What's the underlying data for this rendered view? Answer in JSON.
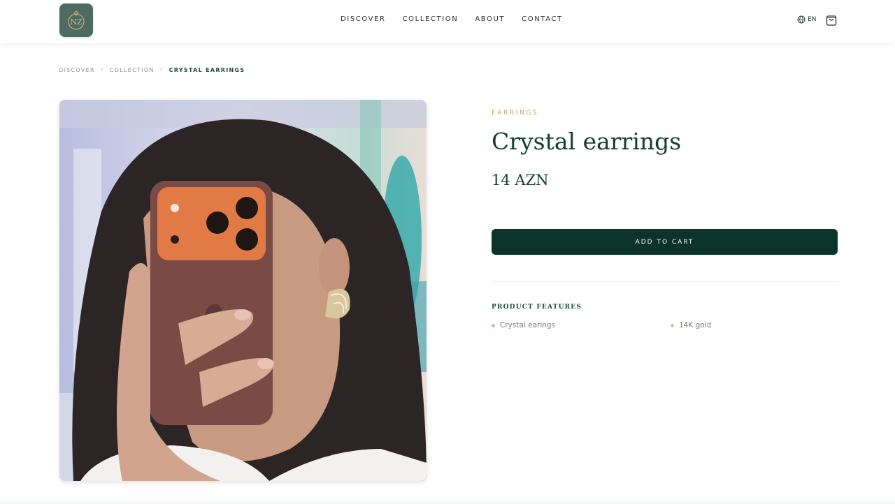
{
  "header": {
    "logo_text": "NZ",
    "nav": [
      "DISCOVER",
      "COLLECTION",
      "ABOUT",
      "CONTACT"
    ],
    "language": "EN"
  },
  "breadcrumb": {
    "items": [
      "DISCOVER",
      "COLLECTION"
    ],
    "current": "CRYSTAL EARRINGS"
  },
  "product": {
    "category": "EARRINGS",
    "title": "Crystal earrings",
    "price": "14 AZN",
    "add_to_cart_label": "ADD TO CART",
    "features_title": "PRODUCT FEATURES",
    "features": [
      "Crystal earings",
      "14K gold"
    ]
  },
  "colors": {
    "brand_dark": "#0b3329",
    "accent_gold": "#c0a06e",
    "logo_bg": "#4e6b63"
  }
}
